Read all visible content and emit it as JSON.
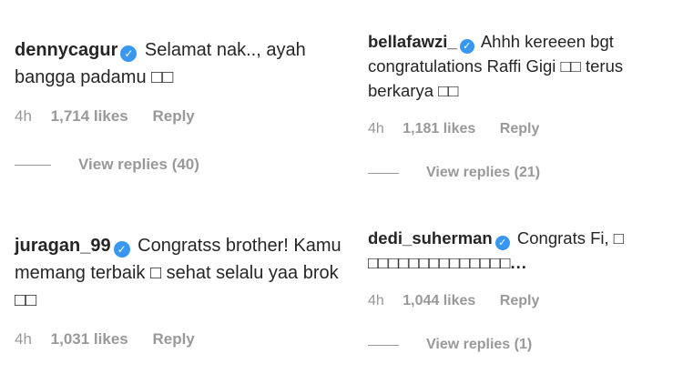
{
  "comments": [
    {
      "username": "dennycagur",
      "verified_icon": "verified-badge-icon",
      "text": "Selamat nak.., ayah bangga padamu □□",
      "time": "4h",
      "likes": "1,714 likes",
      "reply": "Reply",
      "view_replies": "View replies (40)"
    },
    {
      "username": "bellafawzi_",
      "verified_icon": "verified-badge-icon",
      "text": "Ahhh kereeen bgt congratulations Raffi Gigi □□ terus berkarya □□",
      "time": "4h",
      "likes": "1,181 likes",
      "reply": "Reply",
      "view_replies": "View replies (21)"
    },
    {
      "username": "juragan_99",
      "verified_icon": "verified-badge-icon",
      "text": "Congratss brother! Kamu memang terbaik □ sehat selalu yaa brok □□",
      "time": "4h",
      "likes": "1,031 likes",
      "reply": "Reply"
    },
    {
      "username": "dedi_suherman",
      "verified_icon": "verified-badge-icon",
      "text": "Congrats Fi, □ □□□□□□□□□□□□□□",
      "more": "...",
      "time": "4h",
      "likes": "1,044 likes",
      "reply": "Reply",
      "view_replies": "View replies (1)"
    }
  ],
  "colors": {
    "text": "#262626",
    "meta": "#999999",
    "verified": "#3897f0"
  }
}
